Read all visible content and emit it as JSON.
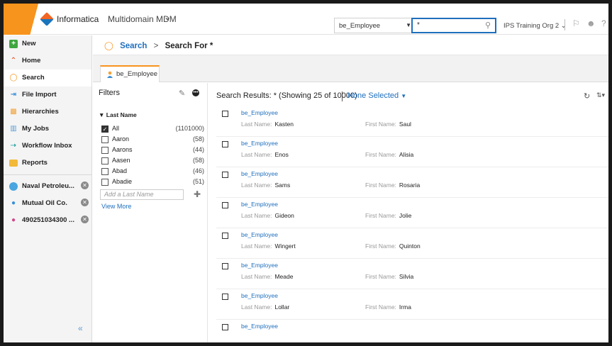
{
  "header": {
    "brand": "Informatica",
    "app": "Multidomain MDM",
    "entity_select": "be_Employee",
    "search_value": "*",
    "org": "IPS Training Org 2"
  },
  "sidebar": {
    "items": [
      {
        "label": "New",
        "icon": "plus-icon"
      },
      {
        "label": "Home",
        "icon": "home-icon"
      },
      {
        "label": "Search",
        "icon": "search-icon"
      },
      {
        "label": "File Import",
        "icon": "file-import-icon"
      },
      {
        "label": "Hierarchies",
        "icon": "hierarchy-icon"
      },
      {
        "label": "My Jobs",
        "icon": "jobs-icon"
      },
      {
        "label": "Workflow Inbox",
        "icon": "workflow-icon"
      },
      {
        "label": "Reports",
        "icon": "folder-icon"
      }
    ],
    "workspace": [
      {
        "label": "Naval Petroleu...",
        "icon": "globe-icon"
      },
      {
        "label": "Mutual Oil Co.",
        "icon": "person-icon"
      },
      {
        "label": "490251034300 ...",
        "icon": "product-icon"
      }
    ]
  },
  "breadcrumb": {
    "root": "Search",
    "sep": ">",
    "current": "Search For *"
  },
  "tab": {
    "label": "be_Employee"
  },
  "filters": {
    "title": "Filters",
    "group": "Last Name",
    "rows": [
      {
        "label": "All",
        "count": "(1101000)",
        "checked": true
      },
      {
        "label": "Aaron",
        "count": "(58)",
        "checked": false
      },
      {
        "label": "Aarons",
        "count": "(44)",
        "checked": false
      },
      {
        "label": "Aasen",
        "count": "(58)",
        "checked": false
      },
      {
        "label": "Abad",
        "count": "(46)",
        "checked": false
      },
      {
        "label": "Abadie",
        "count": "(51)",
        "checked": false
      }
    ],
    "add_placeholder": "Add a Last Name",
    "view_more": "View More"
  },
  "results": {
    "heading": "Search Results: * (Showing 25 of 10000)",
    "none_selected": "None Selected",
    "ln_label": "Last Name:",
    "fn_label": "First Name:",
    "rows": [
      {
        "title": "be_Employee",
        "last": "Kasten",
        "first": "Saul"
      },
      {
        "title": "be_Employee",
        "last": "Enos",
        "first": "Alisia"
      },
      {
        "title": "be_Employee",
        "last": "Sams",
        "first": "Rosaria"
      },
      {
        "title": "be_Employee",
        "last": "Gideon",
        "first": "Jolie"
      },
      {
        "title": "be_Employee",
        "last": "Wingert",
        "first": "Quinton"
      },
      {
        "title": "be_Employee",
        "last": "Meade",
        "first": "Silvia"
      },
      {
        "title": "be_Employee",
        "last": "Lollar",
        "first": "Irma"
      },
      {
        "title": "be_Employee"
      }
    ]
  },
  "colors": {
    "accent": "#f7941d",
    "link": "#1f6fbd"
  }
}
